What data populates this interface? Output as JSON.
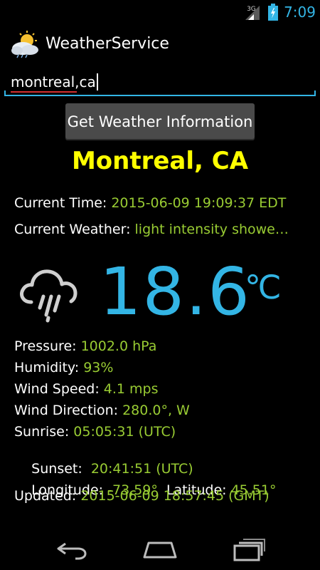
{
  "status_bar": {
    "network": "3G",
    "time": "7:09"
  },
  "app": {
    "title": "WeatherService",
    "icon": "cloud-sun-icon"
  },
  "search": {
    "value": "montreal,ca"
  },
  "button": {
    "label": "Get Weather Information"
  },
  "weather": {
    "city": "Montreal, CA",
    "current_time_label": "Current Time: ",
    "current_time_value": "2015-06-09 19:09:37 EDT",
    "current_weather_label": "Current Weather: ",
    "current_weather_value": "light intensity showe…",
    "icon": "cloud-rain-icon",
    "temperature": "18.6",
    "unit": "℃",
    "pressure_label": "Pressure: ",
    "pressure_value": "1002.0 hPa",
    "humidity_label": "Humidity: ",
    "humidity_value": "93%",
    "wind_speed_label": "Wind Speed: ",
    "wind_speed_value": "4.1 mps",
    "wind_direction_label": "Wind Direction: ",
    "wind_direction_value": "280.0°, W",
    "sunrise_label": "Sunrise: ",
    "sunrise_value": "05:05:31 (UTC)",
    "sunset_label": "Sunset:  ",
    "sunset_value": "20:41:51 (UTC)",
    "longitude_label": "Longitude: ",
    "longitude_value": "-73.59°",
    "latitude_label": "  Latitude: ",
    "latitude_value": "45.51°",
    "updated_label": "Updated: ",
    "updated_value": "2015-06-09 18:57:45 (GMT)"
  },
  "colors": {
    "accent": "#33b5e5",
    "value_green": "#99cc33",
    "city_yellow": "#ffff00"
  },
  "nav": {
    "back": "back-icon",
    "home": "home-icon",
    "recents": "recents-icon"
  }
}
